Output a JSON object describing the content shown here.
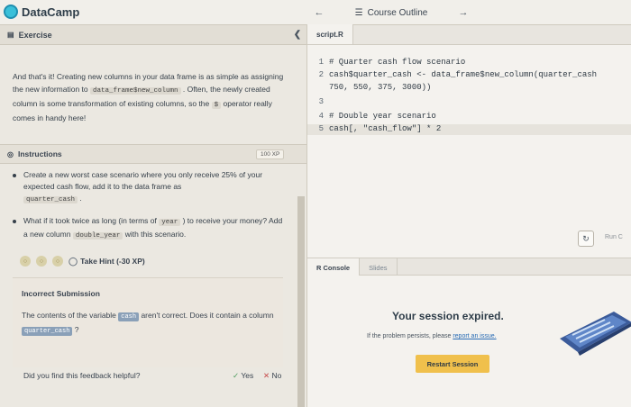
{
  "app": {
    "name": "DataCamp"
  },
  "nav": {
    "back_icon": "arrow-left-icon",
    "outline_label": "Course Outline",
    "forward_icon": "arrow-right-icon"
  },
  "left": {
    "header_label": "Exercise",
    "text_before": "And that's it! Creating new columns in your data frame is as simple as assigning the new information to ",
    "code1": "data_frame$new_column",
    "text_middle": " . Often, the newly created column is some transformation of existing columns, so the ",
    "code2": "$",
    "text_after": " operator really comes in handy here!",
    "instructions_label": "Instructions",
    "xp_badge": "100 XP",
    "bullet1_text": "Create a new worst case scenario where you only receive 25% of your expected cash flow, add it to the data frame as",
    "bullet1_code": "quarter_cash",
    "bullet1_end": ".",
    "bullet2_start": "What if it took twice as long (in terms of ",
    "bullet2_code1": "year",
    "bullet2_mid": " ) to receive your money? Add a new column ",
    "bullet2_code2": "double_year",
    "bullet2_end": " with this scenario.",
    "hint_label": "Take Hint (-30 XP)",
    "incorrect_title": "Incorrect Submission",
    "inc_before": "The contents of the variable ",
    "inc_tag1": "cash",
    "inc_mid": " aren't correct. Does it contain a column ",
    "inc_tag2": "quarter_cash",
    "inc_end": " ?",
    "feedback_q": "Did you find this feedback helpful?",
    "yes_label": "Yes",
    "no_label": "No"
  },
  "editor": {
    "file_tab": "script.R",
    "lines": [
      {
        "n": "1",
        "text": "# Quarter cash flow scenario"
      },
      {
        "n": "2",
        "text": "cash$quarter_cash <- data_frame$new_column(quarter_cash"
      },
      {
        "n": "",
        "text": "750, 550, 375, 3000))"
      },
      {
        "n": "3",
        "text": ""
      },
      {
        "n": "4",
        "text": "# Double year scenario"
      },
      {
        "n": "5",
        "text": "cash[, \"cash_flow\"] * 2"
      }
    ],
    "run_label": "Run C"
  },
  "console": {
    "tab_console": "R Console",
    "tab_slides": "Slides",
    "expired_title": "Your session expired.",
    "expired_sub": "If the problem persists, please ",
    "expired_link": "report an issue.",
    "restart_label": "Restart Session"
  },
  "colors": {
    "accent": "#f0c04c",
    "brand": "#3ac0d9",
    "link": "#2a6db5"
  }
}
